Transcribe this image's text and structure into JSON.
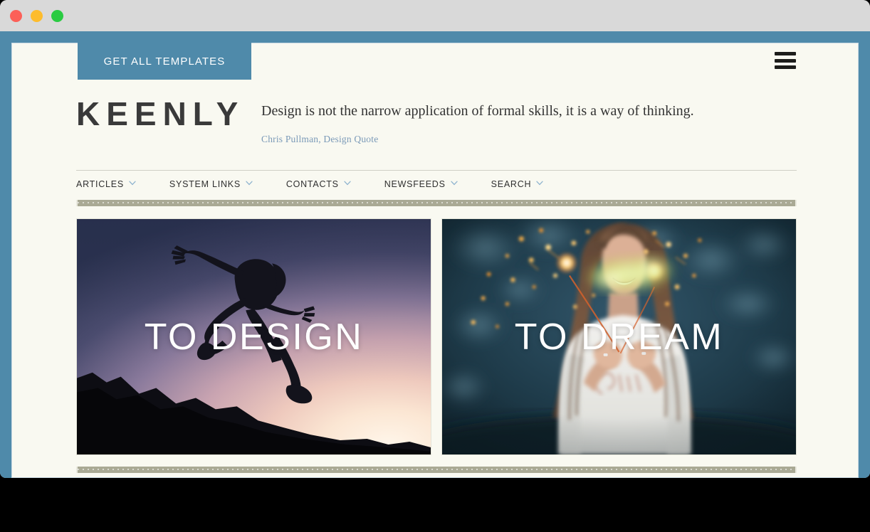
{
  "browser": {
    "traffic_lights": [
      {
        "name": "close",
        "color": "#fc6058"
      },
      {
        "name": "minimize",
        "color": "#fdbc2d"
      },
      {
        "name": "maximize",
        "color": "#2acb42"
      }
    ],
    "frame_color": "#4f8aaa",
    "page_background": "#f9f9f1"
  },
  "cta": {
    "label": "GET ALL TEMPLATES",
    "background": "#4f8aaa",
    "text_color": "#ffffff"
  },
  "menu": {
    "icon": "hamburger-icon",
    "bars": 3,
    "color": "#1d1d1b"
  },
  "header": {
    "logo": "KEENLY",
    "logo_color": "#3a3a3a",
    "quote": "Design is not the narrow application of formal skills, it is a way of thinking.",
    "quote_author": "Chris Pullman, Design Quote",
    "quote_author_color": "#7b9ab8"
  },
  "nav": {
    "items": [
      {
        "label": "ARTICLES",
        "icon": "chevron-down-icon",
        "has_dropdown": true
      },
      {
        "label": "SYSTEM LINKS",
        "icon": "chevron-down-icon",
        "has_dropdown": true
      },
      {
        "label": "CONTACTS",
        "icon": "chevron-down-icon",
        "has_dropdown": true
      },
      {
        "label": "NEWSFEEDS",
        "icon": "chevron-down-icon",
        "has_dropdown": true
      },
      {
        "label": "SEARCH",
        "icon": "chevron-down-icon",
        "has_dropdown": true
      }
    ],
    "divider_color": "#a9a994"
  },
  "cards": [
    {
      "title": "TO DESIGN",
      "image_description": "silhouette of a person leaping over rocks against a dusk sunset sky",
      "accent_dark": "#2b3350",
      "accent_light": "#fff6ea"
    },
    {
      "title": "TO DREAM",
      "image_description": "young woman holding a lit sparkler at night with orange sparks",
      "accent_dark": "#1b3340",
      "accent_light": "#e8f1a8"
    }
  ]
}
